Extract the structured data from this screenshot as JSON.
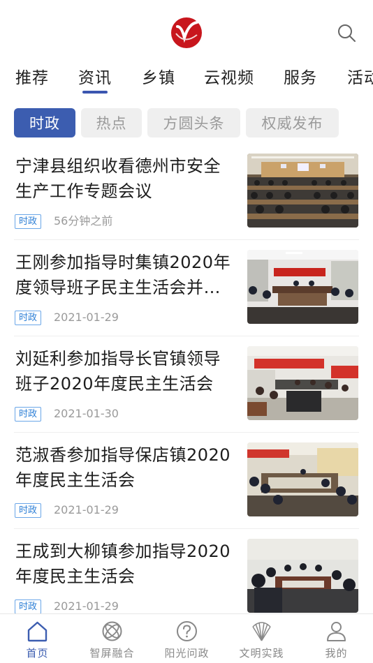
{
  "header": {
    "logo": "app-logo",
    "search_icon": "search-icon"
  },
  "tabs": [
    {
      "label": "推荐"
    },
    {
      "label": "资讯"
    },
    {
      "label": "乡镇"
    },
    {
      "label": "云视频"
    },
    {
      "label": "服务"
    },
    {
      "label": "活动"
    }
  ],
  "active_tab": "资讯",
  "chips": [
    {
      "label": "时政"
    },
    {
      "label": "热点"
    },
    {
      "label": "方圆头条"
    },
    {
      "label": "权威发布"
    }
  ],
  "active_chip": "时政",
  "articles": [
    {
      "title": "宁津县组织收看德州市安全生产工作专题会议",
      "tag": "时政",
      "date": "56分钟之前"
    },
    {
      "title": "王刚参加指导时集镇2020年度领导班子民主生活会并…",
      "tag": "时政",
      "date": "2021-01-29"
    },
    {
      "title": "刘延利参加指导长官镇领导班子2020年度民主生活会",
      "tag": "时政",
      "date": "2021-01-30"
    },
    {
      "title": "范淑香参加指导保店镇2020年度民主生活会",
      "tag": "时政",
      "date": "2021-01-29"
    },
    {
      "title": "王成到大柳镇参加指导2020年度民主生活会",
      "tag": "时政",
      "date": "2021-01-29"
    }
  ],
  "bottom_nav": [
    {
      "label": "首页",
      "icon": "home-icon"
    },
    {
      "label": "智屏融合",
      "icon": "fusion-icon"
    },
    {
      "label": "阳光问政",
      "icon": "question-icon"
    },
    {
      "label": "文明实践",
      "icon": "fan-icon"
    },
    {
      "label": "我的",
      "icon": "user-icon"
    }
  ],
  "colors": {
    "accent": "#3c5db0",
    "tag_border": "#6aa6e8",
    "logo_red": "#c8161d"
  }
}
